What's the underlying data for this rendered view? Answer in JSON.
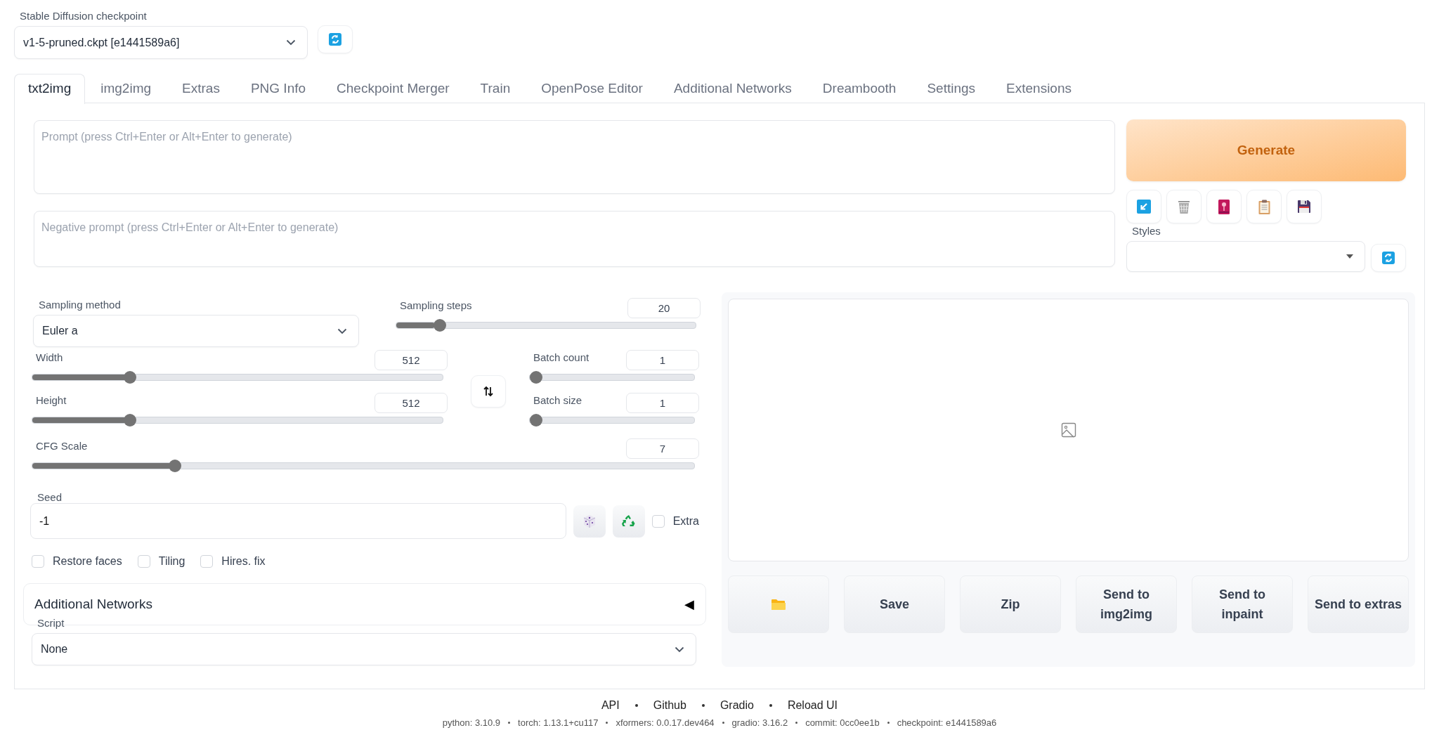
{
  "checkpoint": {
    "label": "Stable Diffusion checkpoint",
    "value": "v1-5-pruned.ckpt [e1441589a6]"
  },
  "tabs": [
    {
      "label": "txt2img",
      "selected": true
    },
    {
      "label": "img2img",
      "selected": false
    },
    {
      "label": "Extras",
      "selected": false
    },
    {
      "label": "PNG Info",
      "selected": false
    },
    {
      "label": "Checkpoint Merger",
      "selected": false
    },
    {
      "label": "Train",
      "selected": false
    },
    {
      "label": "OpenPose Editor",
      "selected": false
    },
    {
      "label": "Additional Networks",
      "selected": false
    },
    {
      "label": "Dreambooth",
      "selected": false
    },
    {
      "label": "Settings",
      "selected": false
    },
    {
      "label": "Extensions",
      "selected": false
    }
  ],
  "prompt": {
    "placeholder": "Prompt (press Ctrl+Enter or Alt+Enter to generate)"
  },
  "negative_prompt": {
    "placeholder": "Negative prompt (press Ctrl+Enter or Alt+Enter to generate)"
  },
  "generate_button": "Generate",
  "styles": {
    "label": "Styles"
  },
  "sampling_method": {
    "label": "Sampling method",
    "value": "Euler a"
  },
  "sliders": [
    {
      "label": "Sampling steps",
      "value": "20",
      "level": 0.13
    },
    {
      "label": "Width",
      "value": "512",
      "level": 0.23
    },
    {
      "label": "Batch count",
      "value": "1",
      "level": 0
    },
    {
      "label": "Height",
      "value": "512",
      "level": 0.23
    },
    {
      "label": "Batch size",
      "value": "1",
      "level": 0
    },
    {
      "label": "CFG Scale",
      "value": "7",
      "level": 0.21
    }
  ],
  "seed": {
    "label": "Seed",
    "value": "-1"
  },
  "extra": {
    "label": "Extra",
    "checked": false
  },
  "options": [
    {
      "label": "Restore faces",
      "checked": false
    },
    {
      "label": "Tiling",
      "checked": false
    },
    {
      "label": "Hires. fix",
      "checked": false
    }
  ],
  "accordion": {
    "title": "Additional Networks",
    "toggle": "◀",
    "expanded": false
  },
  "script": {
    "label": "Script",
    "value": "None"
  },
  "output_buttons": [
    "Save",
    "Zip",
    "Send to img2img",
    "Send to inpaint",
    "Send to extras"
  ],
  "footer": {
    "links": [
      "API",
      "Github",
      "Gradio",
      "Reload UI"
    ],
    "versions": [
      "python: 3.10.9",
      "torch: 1.13.1+cu117",
      "xformers: 0.0.17.dev464",
      "gradio: 3.16.2",
      "commit: 0cc0ee1b",
      "checkpoint: e1441589a6"
    ]
  }
}
